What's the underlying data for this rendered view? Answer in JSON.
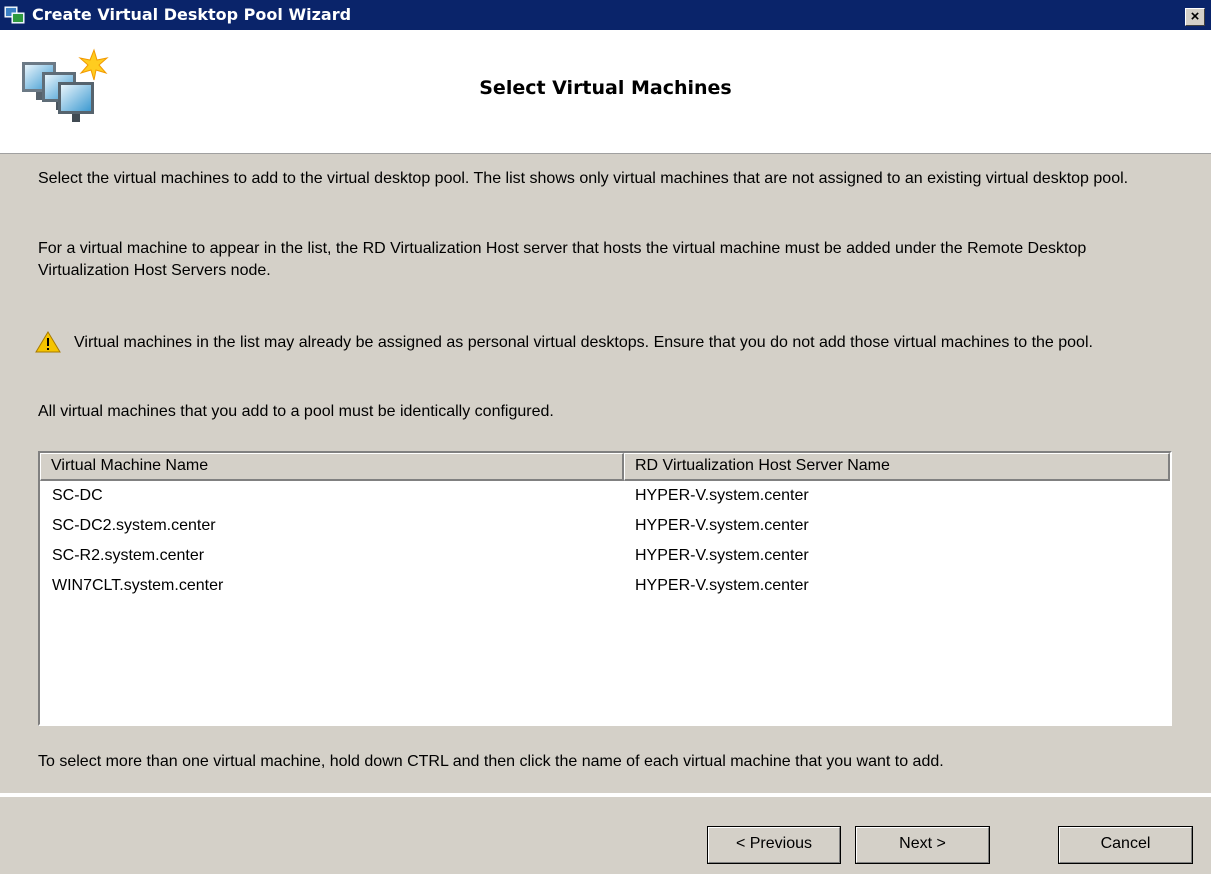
{
  "window": {
    "title": "Create Virtual Desktop Pool Wizard",
    "close_symbol": "×"
  },
  "header": {
    "page_title": "Select Virtual Machines",
    "icon": "virtual-desktops-icon"
  },
  "content": {
    "intro": "Select the virtual machines to add to the virtual desktop pool.  The list shows only virtual machines that are not assigned to an existing virtual desktop pool.",
    "host_note": "For a virtual machine to appear in the list, the RD Virtualization Host server that hosts the virtual machine must be added under the Remote Desktop Virtualization Host Servers node.",
    "warning": "Virtual machines in the list may already be assigned as personal virtual desktops.  Ensure that you do not add those virtual machines to the pool.",
    "config_note": "All virtual machines that you add to a pool must be identically configured.",
    "selection_hint": "To select more than one virtual machine, hold down CTRL and then click the name of each virtual machine that you want to add."
  },
  "list": {
    "columns": [
      "Virtual Machine Name",
      "RD Virtualization Host Server Name"
    ],
    "rows": [
      {
        "vm": "SC-DC",
        "host": "HYPER-V.system.center"
      },
      {
        "vm": "SC-DC2.system.center",
        "host": "HYPER-V.system.center"
      },
      {
        "vm": "SC-R2.system.center",
        "host": "HYPER-V.system.center"
      },
      {
        "vm": "WIN7CLT.system.center",
        "host": "HYPER-V.system.center"
      }
    ]
  },
  "buttons": {
    "previous": "< Previous",
    "next": "Next >",
    "cancel": "Cancel"
  },
  "colors": {
    "titlebar": "#0a246a",
    "dialog_bg": "#d4d0c8",
    "warning": "#f5c400"
  }
}
